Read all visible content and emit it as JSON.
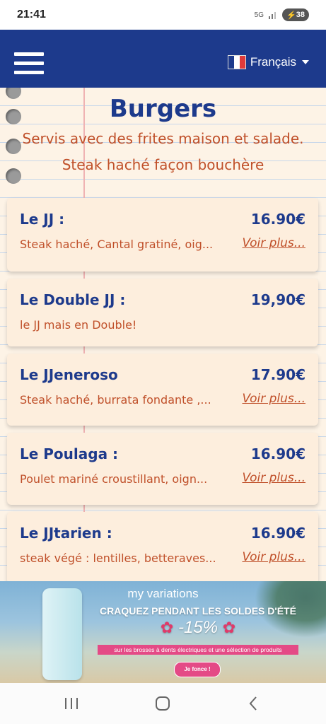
{
  "status_bar": {
    "time": "21:41",
    "network": "5G",
    "battery": "38"
  },
  "header": {
    "menu_icon": "hamburger-menu-icon",
    "language": "Français",
    "flag_colors": [
      "#1d3a8c",
      "#ffffff",
      "#e03a3a"
    ]
  },
  "section": {
    "title": "Burgers",
    "subtitle_1": "Servis avec des frites maison et salade.",
    "subtitle_2": "Steak haché façon bouchère"
  },
  "menu_items": [
    {
      "name": "Le JJ :",
      "price": "16.90€",
      "description": "Steak haché, Cantal gratiné, oig...",
      "more": "Voir plus..."
    },
    {
      "name": "Le Double JJ :",
      "price": "19,90€",
      "description": "le JJ mais en Double!",
      "more": ""
    },
    {
      "name": "Le JJeneroso",
      "price": "17.90€",
      "description": "Steak haché, burrata fondante ,...",
      "more": "Voir plus..."
    },
    {
      "name": "Le Poulaga :",
      "price": "16.90€",
      "description": "Poulet mariné croustillant, oign...",
      "more": "Voir plus..."
    },
    {
      "name": "Le JJtarien :",
      "price": "16.90€",
      "description": "steak végé : lentilles, betteraves...",
      "more": "Voir plus..."
    }
  ],
  "ad": {
    "brand": "my variations",
    "headline": "CRAQUEZ PENDANT LES SOLDES D'ÉTÉ",
    "discount": "-15%",
    "subline": "sur les brosses à dents électriques et une sélection de produits",
    "cta": "Je fonce !"
  },
  "nav": {
    "recents_icon": "recents-icon",
    "home_icon": "home-icon",
    "back_icon": "back-icon"
  },
  "colors": {
    "primary": "#1d3a8c",
    "accent": "#c0502a",
    "card": "#fdeedd",
    "ad_pink": "#e44a86"
  }
}
